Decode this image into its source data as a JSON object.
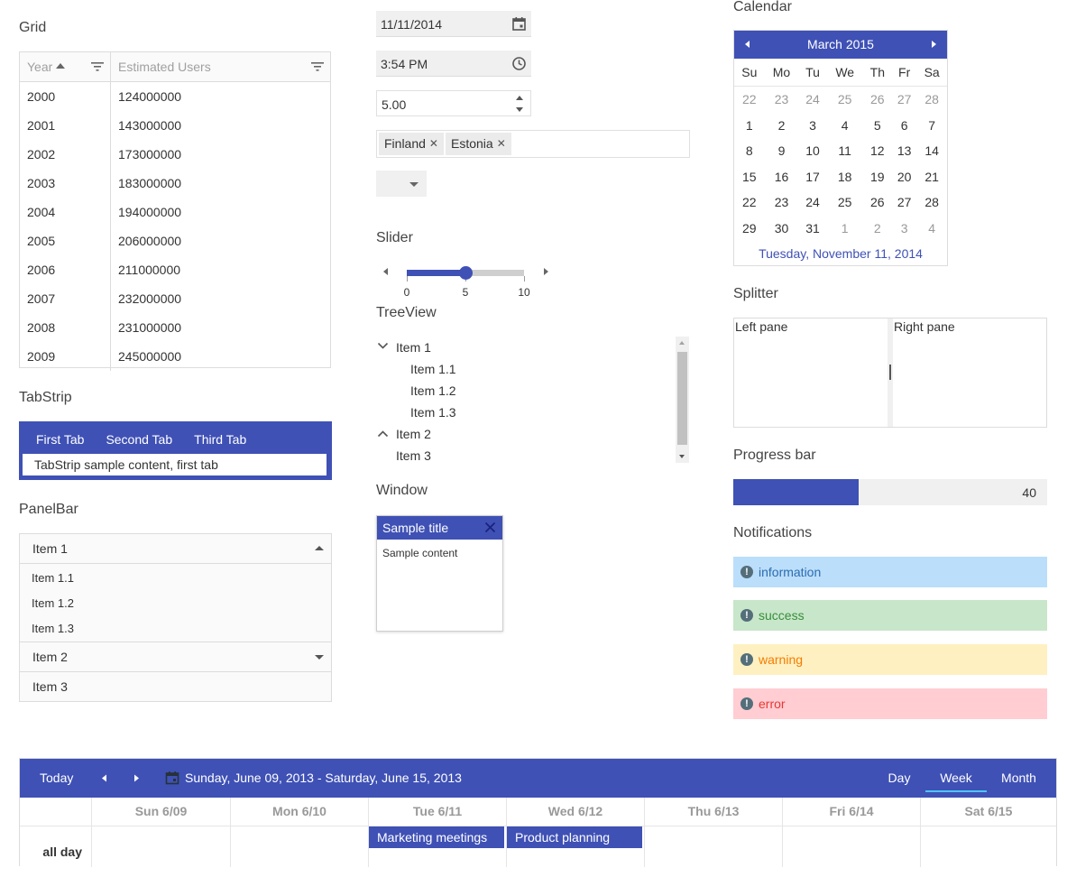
{
  "grid": {
    "title": "Grid",
    "columns": [
      "Year",
      "Estimated Users"
    ],
    "rows": [
      [
        "2000",
        "124000000"
      ],
      [
        "2001",
        "143000000"
      ],
      [
        "2002",
        "173000000"
      ],
      [
        "2003",
        "183000000"
      ],
      [
        "2004",
        "194000000"
      ],
      [
        "2005",
        "206000000"
      ],
      [
        "2006",
        "211000000"
      ],
      [
        "2007",
        "232000000"
      ],
      [
        "2008",
        "231000000"
      ],
      [
        "2009",
        "245000000"
      ]
    ]
  },
  "tabstrip": {
    "title": "TabStrip",
    "tabs": [
      "First Tab",
      "Second Tab",
      "Third Tab"
    ],
    "content": "TabStrip sample content, first tab"
  },
  "panelbar": {
    "title": "PanelBar",
    "item1": "Item 1",
    "subitems": [
      "Item 1.1",
      "Item 1.2",
      "Item 1.3"
    ],
    "item2": "Item 2",
    "item3": "Item 3"
  },
  "inputs": {
    "date": "11/11/2014",
    "time": "3:54 PM",
    "numeric": "5.00",
    "tags": [
      "Finland",
      "Estonia"
    ]
  },
  "slider": {
    "title": "Slider",
    "min": 0,
    "max": 10,
    "value": 5,
    "tick_labels": [
      "0",
      "5",
      "10"
    ]
  },
  "treeview": {
    "title": "TreeView",
    "item1": "Item 1",
    "item1_1": "Item 1.1",
    "item1_2": "Item 1.2",
    "item1_3": "Item 1.3",
    "item2": "Item 2",
    "item3": "Item 3"
  },
  "window": {
    "section_title": "Window",
    "title": "Sample title",
    "content": "Sample content"
  },
  "calendar": {
    "section_title": "Calendar",
    "month": "March 2015",
    "weekdays": [
      "Su",
      "Mo",
      "Tu",
      "We",
      "Th",
      "Fr",
      "Sa"
    ],
    "weeks": [
      [
        "22",
        "23",
        "24",
        "25",
        "26",
        "27",
        "28"
      ],
      [
        "1",
        "2",
        "3",
        "4",
        "5",
        "6",
        "7"
      ],
      [
        "8",
        "9",
        "10",
        "11",
        "12",
        "13",
        "14"
      ],
      [
        "15",
        "16",
        "17",
        "18",
        "19",
        "20",
        "21"
      ],
      [
        "22",
        "23",
        "24",
        "25",
        "26",
        "27",
        "28"
      ],
      [
        "29",
        "30",
        "31",
        "1",
        "2",
        "3",
        "4"
      ]
    ],
    "footer": "Tuesday, November 11, 2014"
  },
  "splitter": {
    "title": "Splitter",
    "left": "Left pane",
    "right": "Right pane"
  },
  "progress": {
    "title": "Progress bar",
    "value": 40,
    "max": 100,
    "label": "40"
  },
  "notifications": {
    "title": "Notifications",
    "items": [
      {
        "text": "information",
        "bg": "#bbdefb",
        "fg": "#2b6cb0",
        "icon": "#546e7a"
      },
      {
        "text": "success",
        "bg": "#c8e6c9",
        "fg": "#388e3c",
        "icon": "#546e7a"
      },
      {
        "text": "warning",
        "bg": "#fff0c1",
        "fg": "#f57c00",
        "icon": "#546e7a"
      },
      {
        "text": "error",
        "bg": "#ffcdd2",
        "fg": "#e53935",
        "icon": "#546e7a"
      }
    ]
  },
  "scheduler": {
    "today": "Today",
    "range": "Sunday, June 09, 2013 - Saturday, June 15, 2013",
    "views": [
      "Day",
      "Week",
      "Month"
    ],
    "active_view": "Week",
    "days": [
      "Sun 6/09",
      "Mon 6/10",
      "Tue 6/11",
      "Wed 6/12",
      "Thu 6/13",
      "Fri 6/14",
      "Sat 6/15"
    ],
    "allday_label": "all day",
    "events": [
      {
        "title": "Marketing meetings",
        "day": 2
      },
      {
        "title": "Product planning",
        "day": 3
      }
    ]
  },
  "colors": {
    "accent": "#3f51b5",
    "accent_light": "#4fc3f7"
  }
}
